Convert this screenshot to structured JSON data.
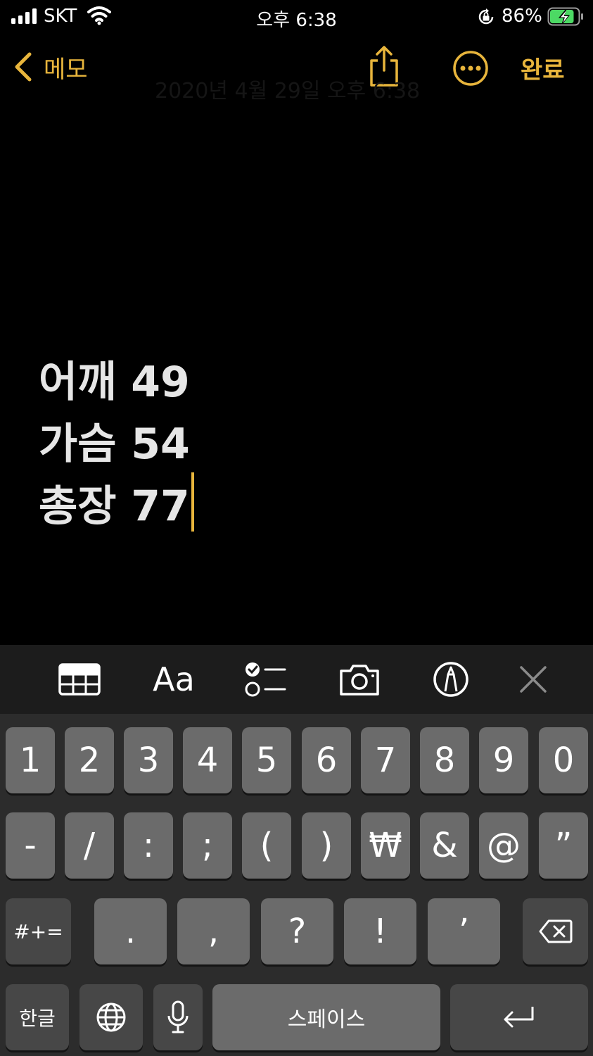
{
  "status_bar": {
    "carrier": "SKT",
    "time": "오후 6:38",
    "battery_percent": "86%",
    "battery_level": 0.86,
    "icons": [
      "signal-icon",
      "wifi-icon",
      "rotation-lock-icon",
      "battery-charging-icon"
    ]
  },
  "nav": {
    "back_label": "메모",
    "done_label": "완료",
    "faded_date": "2020년 4월 29일 오후 6:38",
    "icons": [
      "chevron-left-icon",
      "share-icon",
      "more-icon"
    ]
  },
  "note": {
    "lines": [
      "어깨 49",
      "가슴 54",
      "총장 77"
    ]
  },
  "toolbar": {
    "format_label": "Aa",
    "icons": [
      "table-icon",
      "checklist-icon",
      "camera-icon",
      "markup-icon",
      "close-icon"
    ]
  },
  "keyboard": {
    "row1": [
      "1",
      "2",
      "3",
      "4",
      "5",
      "6",
      "7",
      "8",
      "9",
      "0"
    ],
    "row2": [
      "-",
      "/",
      ":",
      ";",
      "(",
      ")",
      "₩",
      "&",
      "@",
      "”"
    ],
    "row3": {
      "mode_label": "#+=",
      "keys": [
        ".",
        ",",
        "?",
        "!",
        "’"
      ]
    },
    "row4": {
      "lang_label": "한글",
      "space_label": "스페이스"
    },
    "icons": [
      "delete-icon",
      "globe-icon",
      "microphone-icon",
      "return-icon"
    ]
  },
  "colors": {
    "accent": "#e8b53c",
    "background": "#000000",
    "keyboard_bg": "#2c2c2c",
    "key": "#6b6b6b",
    "key_dark": "#474747",
    "toolbar_bg": "#1c1c1c"
  }
}
